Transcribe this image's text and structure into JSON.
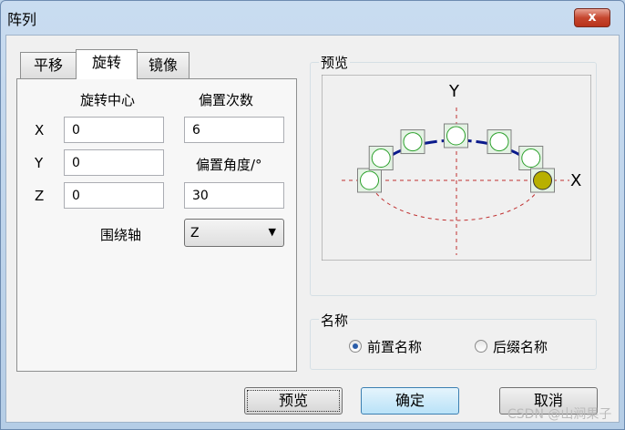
{
  "window": {
    "title": "阵列",
    "close_label": "x"
  },
  "tabs": [
    {
      "label": "平移"
    },
    {
      "label": "旋转",
      "active": true
    },
    {
      "label": "镜像"
    }
  ],
  "rotate": {
    "center_label": "旋转中心",
    "count_label": "偏置次数",
    "angle_label": "偏置角度/°",
    "axis_label": "围绕轴",
    "x_label": "X",
    "y_label": "Y",
    "z_label": "Z",
    "center_x": "0",
    "center_y": "0",
    "center_z": "0",
    "count": "6",
    "angle": "30",
    "axis": "Z"
  },
  "preview": {
    "group_label": "预览",
    "x_axis": "X",
    "y_axis": "Y",
    "point_count": 7,
    "arc_degrees": 180
  },
  "naming": {
    "group_label": "名称",
    "options": [
      {
        "label": "前置名称",
        "checked": true
      },
      {
        "label": "后缀名称",
        "checked": false
      }
    ]
  },
  "buttons": {
    "preview": "预览",
    "ok": "确定",
    "cancel": "取消"
  },
  "watermark": "CSDN @山涧果子",
  "colors": {
    "arc": "#0a1a8c",
    "point_stroke": "#2aa02a",
    "selected_point": "#b8b000",
    "axis": "#c03030"
  }
}
